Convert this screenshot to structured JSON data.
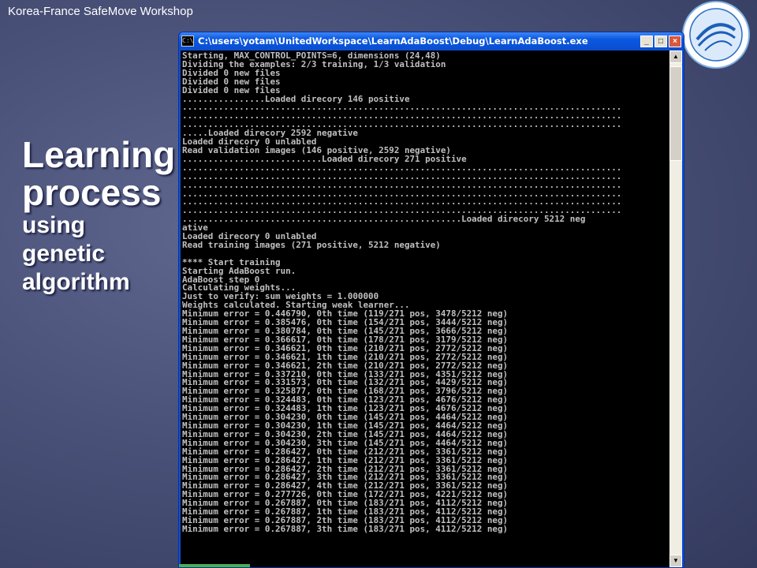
{
  "header": {
    "text": "Korea-France SafeMove Workshop"
  },
  "logo": {
    "name": "school-seal-icon"
  },
  "title": {
    "line1": "Learning",
    "line2": "process",
    "line3": "using",
    "line4": "genetic",
    "line5": "algorithm"
  },
  "window": {
    "title": "C:\\users\\yotam\\UnitedWorkspace\\LearnAdaBoost\\Debug\\LearnAdaBoost.exe",
    "minimize": "_",
    "maximize": "□",
    "close": "×",
    "console_lines": [
      "Starting, MAX_CONTROL_POINTS=6, dimensions (24,48)",
      "Dividing the examples: 2/3 training, 1/3 validation",
      "Divided 0 new files",
      "Divided 0 new files",
      "Divided 0 new files",
      "................Loaded direcory 146 positive",
      ".....................................................................................",
      ".....................................................................................",
      ".....................................................................................",
      ".....Loaded direcory 2592 negative",
      "Loaded direcory 0 unlabled",
      "Read validation images (146 positive, 2592 negative)",
      "...........................Loaded direcory 271 positive",
      ".....................................................................................",
      ".....................................................................................",
      ".....................................................................................",
      ".....................................................................................",
      ".....................................................................................",
      ".....................................................................................",
      "......................................................Loaded direcory 5212 neg",
      "ative",
      "Loaded direcory 0 unlabled",
      "Read training images (271 positive, 5212 negative)",
      "",
      "**** Start training",
      "Starting AdaBoost run.",
      "AdaBoost step 0",
      "Calculating weights...",
      "Just to verify: sum weights = 1.000000",
      "Weights calculated. Starting weak learner...",
      "Minimum error = 0.446790, 0th time (119/271 pos, 3478/5212 neg)",
      "Minimum error = 0.385476, 0th time (154/271 pos, 3444/5212 neg)",
      "Minimum error = 0.380784, 0th time (145/271 pos, 3666/5212 neg)",
      "Minimum error = 0.366617, 0th time (178/271 pos, 3179/5212 neg)",
      "Minimum error = 0.346621, 0th time (210/271 pos, 2772/5212 neg)",
      "Minimum error = 0.346621, 1th time (210/271 pos, 2772/5212 neg)",
      "Minimum error = 0.346621, 2th time (210/271 pos, 2772/5212 neg)",
      "Minimum error = 0.337210, 0th time (133/271 pos, 4351/5212 neg)",
      "Minimum error = 0.331573, 0th time (132/271 pos, 4429/5212 neg)",
      "Minimum error = 0.325877, 0th time (168/271 pos, 3796/5212 neg)",
      "Minimum error = 0.324483, 0th time (123/271 pos, 4676/5212 neg)",
      "Minimum error = 0.324483, 1th time (123/271 pos, 4676/5212 neg)",
      "Minimum error = 0.304230, 0th time (145/271 pos, 4464/5212 neg)",
      "Minimum error = 0.304230, 1th time (145/271 pos, 4464/5212 neg)",
      "Minimum error = 0.304230, 2th time (145/271 pos, 4464/5212 neg)",
      "Minimum error = 0.304230, 3th time (145/271 pos, 4464/5212 neg)",
      "Minimum error = 0.286427, 0th time (212/271 pos, 3361/5212 neg)",
      "Minimum error = 0.286427, 1th time (212/271 pos, 3361/5212 neg)",
      "Minimum error = 0.286427, 2th time (212/271 pos, 3361/5212 neg)",
      "Minimum error = 0.286427, 3th time (212/271 pos, 3361/5212 neg)",
      "Minimum error = 0.286427, 4th time (212/271 pos, 3361/5212 neg)",
      "Minimum error = 0.277726, 0th time (172/271 pos, 4221/5212 neg)",
      "Minimum error = 0.267887, 0th time (183/271 pos, 4112/5212 neg)",
      "Minimum error = 0.267887, 1th time (183/271 pos, 4112/5212 neg)",
      "Minimum error = 0.267887, 2th time (183/271 pos, 4112/5212 neg)",
      "Minimum error = 0.267887, 3th time (183/271 pos, 4112/5212 neg)"
    ]
  },
  "colors": {
    "slide_bg": "#4a5178",
    "console_bg": "#000000",
    "console_text": "#c0c0c0",
    "titlebar": "#0a58e0"
  }
}
